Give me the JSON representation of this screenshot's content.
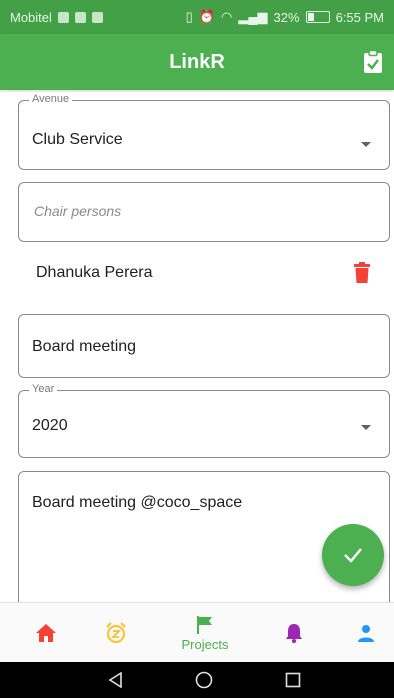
{
  "status_bar": {
    "carrier": "Mobitel",
    "battery": "32%",
    "time": "6:55 PM"
  },
  "app_bar": {
    "title": "LinkR"
  },
  "form": {
    "avenue": {
      "label": "Avenue",
      "value": "Club Service"
    },
    "chair_persons": {
      "placeholder": "Chair persons",
      "value": ""
    },
    "selected_person": "Dhanuka Perera",
    "project_title": {
      "value": "Board meeting"
    },
    "year": {
      "label": "Year",
      "value": "2020"
    },
    "description": {
      "value": "Board meeting @coco_space"
    }
  },
  "bottom_nav": {
    "active": "projects",
    "projects_label": "Projects",
    "colors": {
      "home": "#f44336",
      "alarm": "#fbc02d",
      "projects": "#4caf50",
      "notifications": "#9c27b0",
      "profile": "#2196f3"
    }
  },
  "colors": {
    "primary": "#4caf50",
    "status_bar": "#43a047",
    "delete": "#f44336"
  }
}
